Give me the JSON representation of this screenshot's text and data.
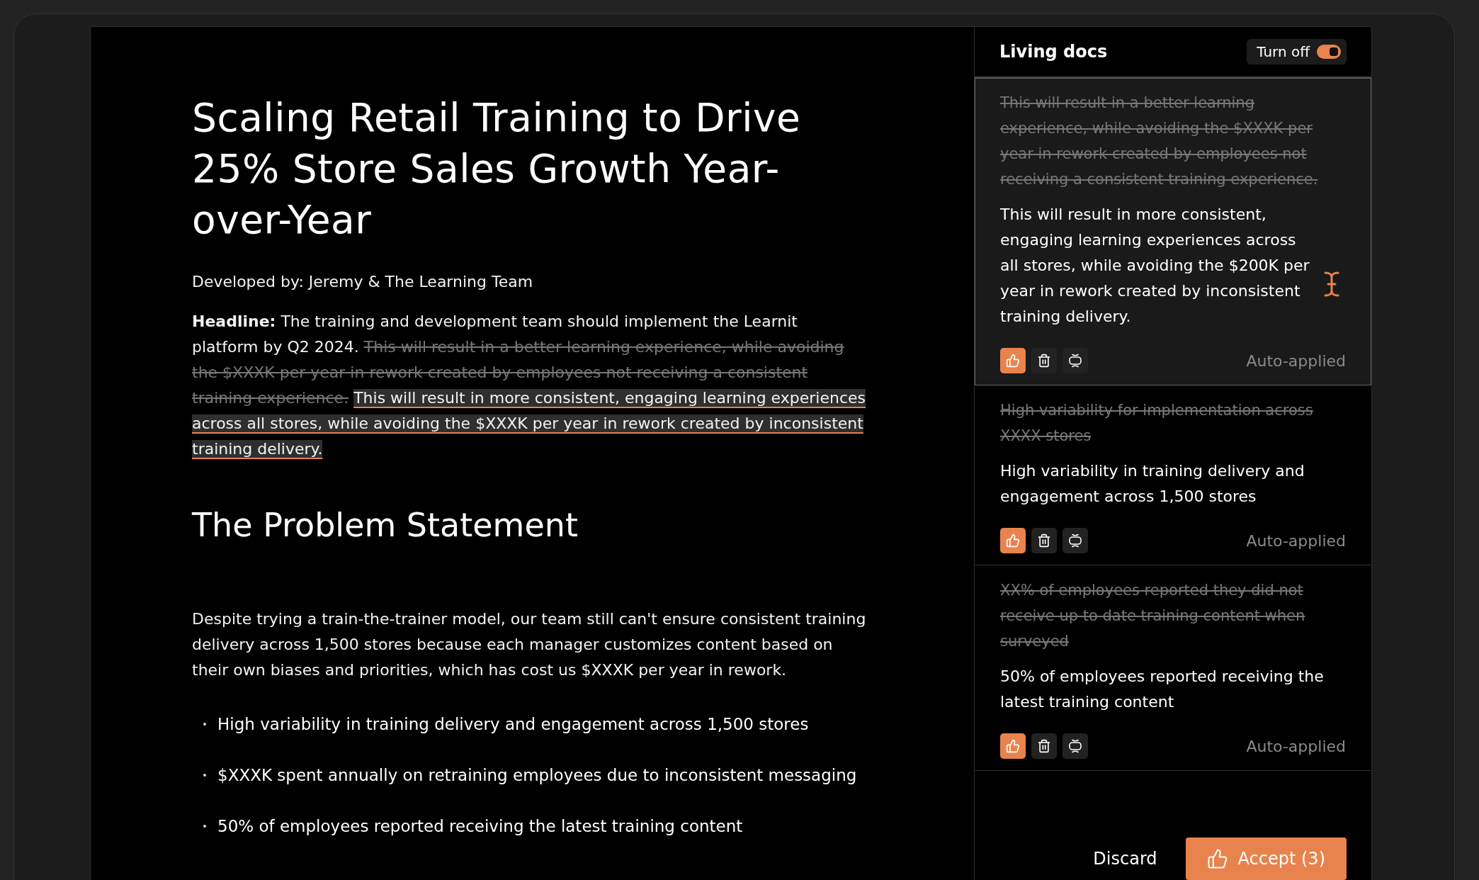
{
  "document": {
    "title": "Scaling Retail Training to Drive 25% Store Sales Growth Year-over-Year",
    "byline": "Developed by: Jeremy & The Learning Team",
    "headline": [
      {
        "kind": "label",
        "text": "Headline:"
      },
      {
        "kind": "plain",
        "text": "The training and development team should implement the Learnit platform by Q2 2024."
      },
      {
        "kind": "removed",
        "text": "This will result in a better learning experience, while avoiding the $XXXK per year in rework created by employees not receiving a consistent training experience."
      },
      {
        "kind": "added",
        "text": "This will result in more consistent, engaging learning experiences across all stores, while avoiding the $XXXK per year in rework created by inconsistent training delivery."
      }
    ],
    "sections": [
      {
        "heading": "The Problem Statement",
        "paragraph": "Despite trying a train-the-trainer model, our team still can't ensure consistent training delivery across 1,500 stores because each manager customizes content based on their own biases and priorities, which has cost us $XXXK per year in rework.",
        "bullets": [
          "High variability in training delivery and engagement across 1,500 stores",
          "$XXXK spent annually on retraining employees due to inconsistent messaging",
          "50% of employees reported receiving the latest training content"
        ]
      }
    ]
  },
  "panel": {
    "title": "Living docs",
    "toggle": {
      "label": "Turn off",
      "on": true
    },
    "suggestions": [
      {
        "removed": "This will result in a better learning experience, while avoiding the $XXXK per year in rework created by employees not receiving a consistent training experience.",
        "added": "This will result in more consistent, engaging learning experiences across all stores, while avoiding the $200K per year in rework created by inconsistent training delivery.",
        "status": "Auto-applied",
        "accepted": true,
        "selected": true
      },
      {
        "removed": "High variability for implementation across XXXX stores",
        "added": "High variability in training delivery and engagement across 1,500 stores",
        "status": "Auto-applied",
        "accepted": true,
        "selected": false
      },
      {
        "removed": "XX% of employees reported they did not receive up to date training content when surveyed",
        "added": "50% of employees reported receiving the latest training content",
        "status": "Auto-applied",
        "accepted": true,
        "selected": false
      }
    ],
    "discard": "Discard",
    "accept": "Accept (3)"
  }
}
